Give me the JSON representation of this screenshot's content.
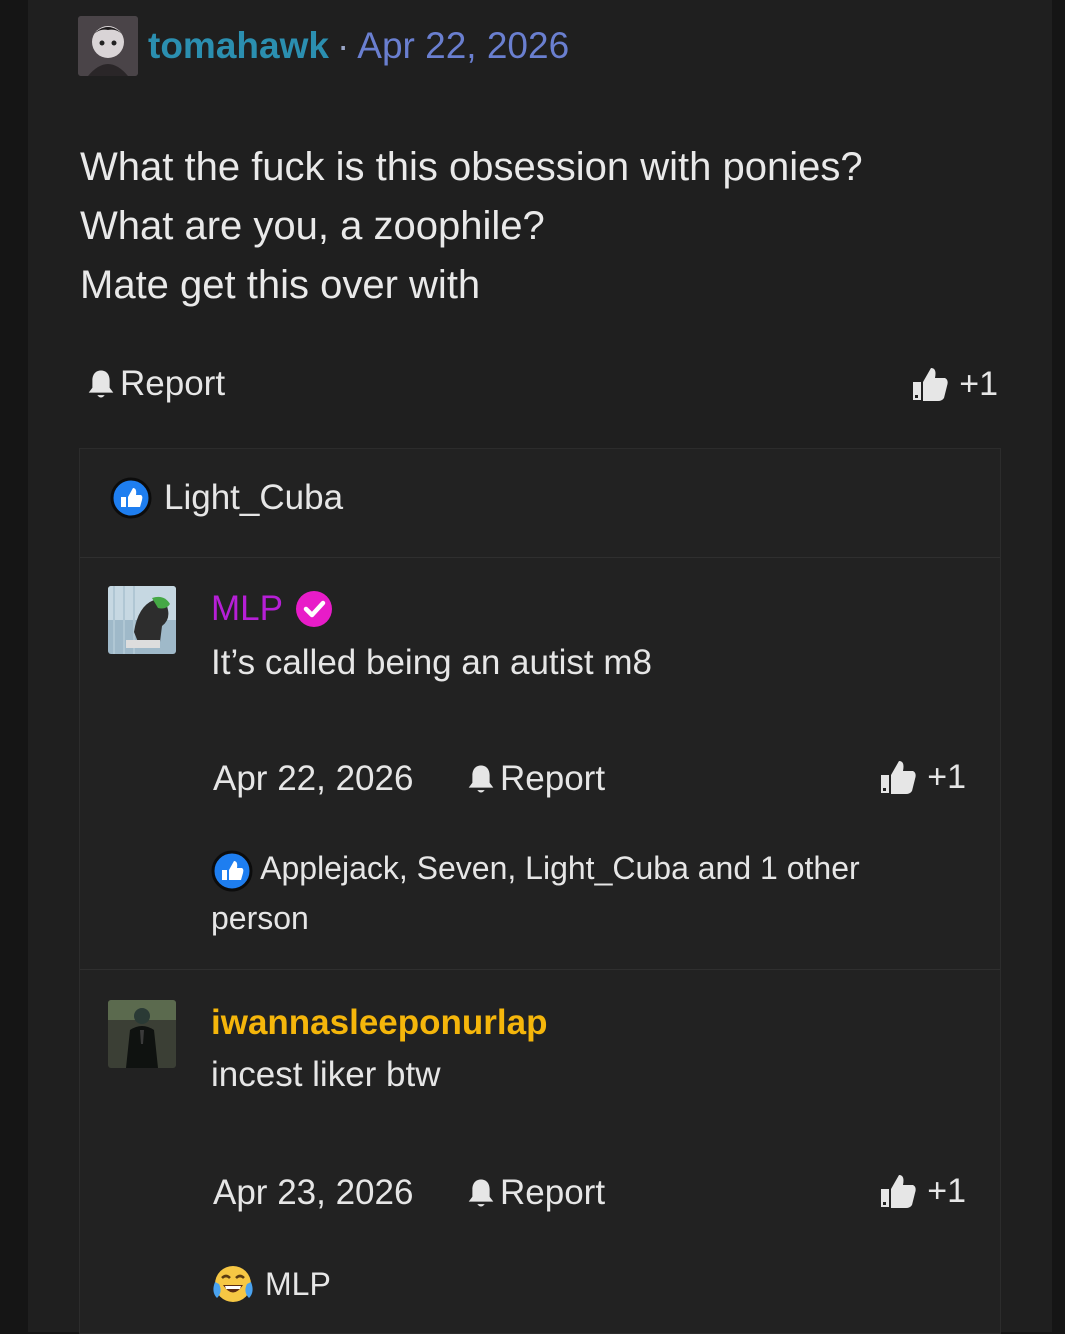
{
  "post": {
    "username": "tomahawk",
    "separator": "·",
    "date": "Apr 22, 2026",
    "body_lines": [
      "What the fuck is this obsession with ponies?",
      "What are you, a zoophile?",
      "Mate get this over with"
    ],
    "report_label": "Report",
    "like_count": "+1",
    "reactions_summary": "Light_Cuba"
  },
  "comments": [
    {
      "username": "MLP",
      "username_color": "#b61fd6",
      "verified": true,
      "text": "It’s called being an autist m8",
      "date": "Apr 22, 2026",
      "report_label": "Report",
      "like_count": "+1",
      "reactors_line1": "Applejack, Seven, Light_Cuba and 1 other",
      "reactors_line2": "person",
      "reaction_icon": "like-icon"
    },
    {
      "username": "iwannasleeponurlap",
      "username_color": "#f5b60b",
      "verified": false,
      "text": "incest liker btw",
      "date": "Apr 23, 2026",
      "report_label": "Report",
      "like_count": "+1",
      "reactors_line1": "MLP",
      "reaction_icon": "laughing-crying-emoji-icon"
    }
  ],
  "colors": {
    "background": "#1f1f1f",
    "post_username": "#2b8fb0",
    "post_date": "#6a7fd0",
    "like_blue": "#1e7ef0"
  }
}
